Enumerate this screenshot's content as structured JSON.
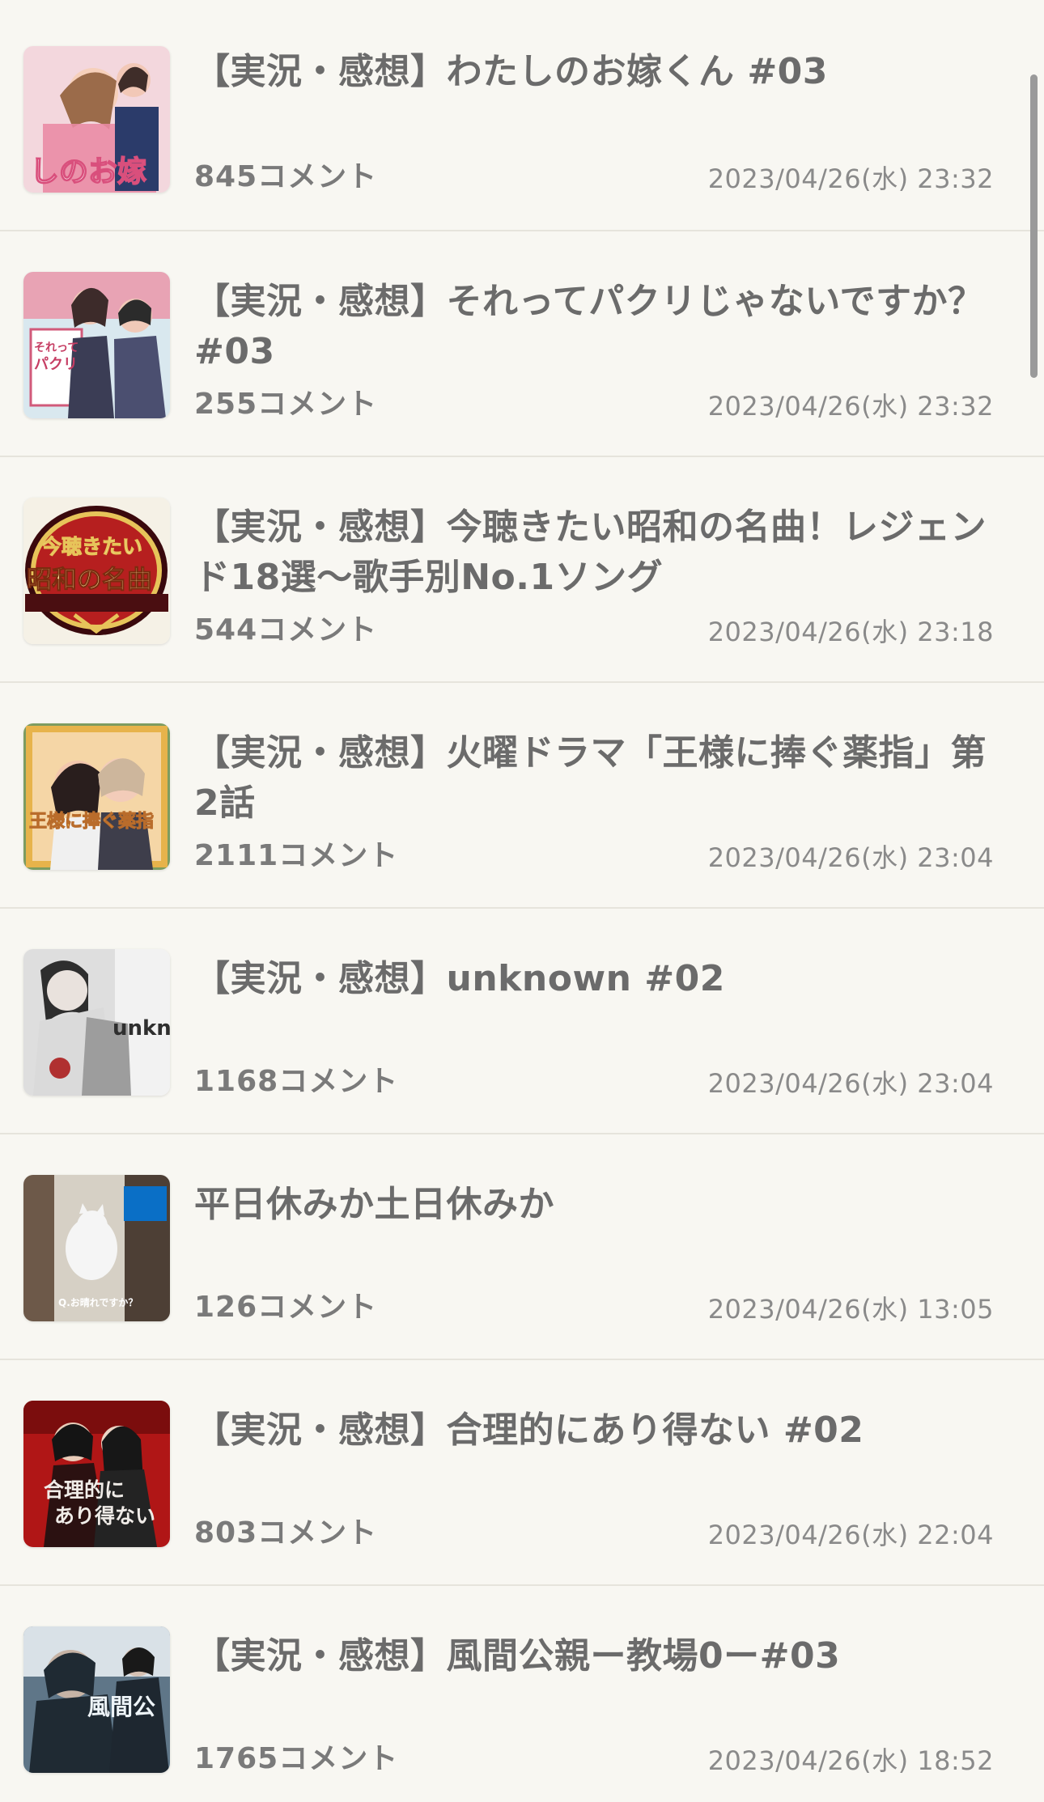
{
  "topics": [
    {
      "title": "【実況・感想】わたしのお嫁くん #03",
      "comments": "845コメント",
      "date": "2023/04/26(水) 23:32",
      "thumbnail_icon": "drama-poster-pink-image",
      "thumb_colors": [
        "#f3d7dd",
        "#e98aa4",
        "#ffffff"
      ]
    },
    {
      "title": "【実況・感想】それってパクリじゃないですか？ #03",
      "comments": "255コメント",
      "date": "2023/04/26(水) 23:32",
      "thumbnail_icon": "drama-poster-office-image",
      "thumb_colors": [
        "#d9e8ef",
        "#4b4f70",
        "#f7d2d7"
      ]
    },
    {
      "title": "【実況・感想】今聴きたい昭和の名曲！レジェンド18選〜歌手別No.1ソング",
      "comments": "544コメント",
      "date": "2023/04/26(水) 23:18",
      "thumbnail_icon": "music-show-logo-image",
      "thumb_colors": [
        "#3a090d",
        "#b61f1f",
        "#e7c45a"
      ]
    },
    {
      "title": "【実況・感想】火曜ドラマ「王様に捧ぐ薬指」第2話",
      "comments": "2111コメント",
      "date": "2023/04/26(水) 23:04",
      "thumbnail_icon": "drama-poster-gold-frame-image",
      "thumb_colors": [
        "#f5d6a6",
        "#e7b34b",
        "#7d9c60"
      ]
    },
    {
      "title": "【実況・感想】unknown #02",
      "comments": "1168コメント",
      "date": "2023/04/26(水) 23:04",
      "thumbnail_icon": "drama-poster-monochrome-image",
      "thumb_colors": [
        "#f2f2f2",
        "#2f2f2f",
        "#b03030"
      ]
    },
    {
      "title": "平日休みか土日休みか",
      "comments": "126コメント",
      "date": "2023/04/26(水) 13:05",
      "thumbnail_icon": "cat-photo-image",
      "thumb_colors": [
        "#d6d0c5",
        "#4c3a2d",
        "#f5f5f5"
      ]
    },
    {
      "title": "【実況・感想】合理的にあり得ない #02",
      "comments": "803コメント",
      "date": "2023/04/26(水) 22:04",
      "thumbnail_icon": "drama-poster-red-image",
      "thumb_colors": [
        "#b01616",
        "#2b1111",
        "#f0ece8"
      ]
    },
    {
      "title": "【実況・感想】風間公親ー教場0ー#03",
      "comments": "1765コメント",
      "date": "2023/04/26(水) 18:52",
      "thumbnail_icon": "drama-poster-blue-image",
      "thumb_colors": [
        "#5f7688",
        "#1f2a33",
        "#d9e1e7"
      ]
    }
  ],
  "thumb_texts": {
    "0": "しのお嫁",
    "1": "それって\nパクリ",
    "2": "今聴きたい\n昭和の名曲",
    "3": "王様に捧ぐ薬指",
    "4": "unkn",
    "5": "Q.お晴れですか？",
    "6": "合理的に\nあり得ない",
    "7": "風間公"
  },
  "scrollbar_label": ""
}
